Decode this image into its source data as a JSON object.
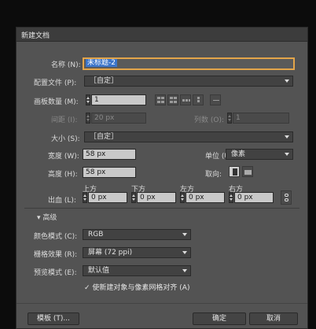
{
  "dialog": {
    "title": "新建文档",
    "name_label": "名称 (N):",
    "name_value": "未标题-2",
    "profile_label": "配置文件 (P):",
    "profile_value": "［自定］",
    "artboards_label": "画板数量 (M):",
    "artboards_value": "1",
    "spacing_label": "间距 (I):",
    "spacing_value": "20 px",
    "columns_label": "列数 (O):",
    "columns_value": "1",
    "size_label": "大小 (S):",
    "size_value": "［自定］",
    "width_label": "宽度 (W):",
    "width_value": "58 px",
    "units_label": "单位 (U):",
    "units_value": "像素",
    "height_label": "高度 (H):",
    "height_value": "58 px",
    "orientation_label": "取向:",
    "bleed_label": "出血 (L):",
    "bleed_top_label": "上方",
    "bleed_bottom_label": "下方",
    "bleed_left_label": "左方",
    "bleed_right_label": "右方",
    "bleed_top_value": "0 px",
    "bleed_bottom_value": "0 px",
    "bleed_left_value": "0 px",
    "bleed_right_value": "0 px",
    "advanced_label": "高级",
    "color_mode_label": "颜色模式 (C):",
    "color_mode_value": "RGB",
    "raster_label": "栅格效果 (R):",
    "raster_value": "屏幕 (72 ppi)",
    "preview_label": "预览模式 (E):",
    "preview_value": "默认值",
    "align_pixel_label": "使新建对象与像素网格对齐 (A)",
    "templates_button": "模板 (T)...",
    "ok_button": "确定",
    "cancel_button": "取消"
  },
  "colors": {
    "background": "#0c0c0c",
    "dialog": "#535353",
    "focus_border": "#e3a54a",
    "selection": "#3b74c9"
  },
  "icons": [
    "dropdown-arrow-icon",
    "stepper-icon",
    "portrait-icon",
    "landscape-icon",
    "link-icon",
    "checkmark-icon",
    "triangle-down-icon",
    "grid-arrangement-icon"
  ]
}
